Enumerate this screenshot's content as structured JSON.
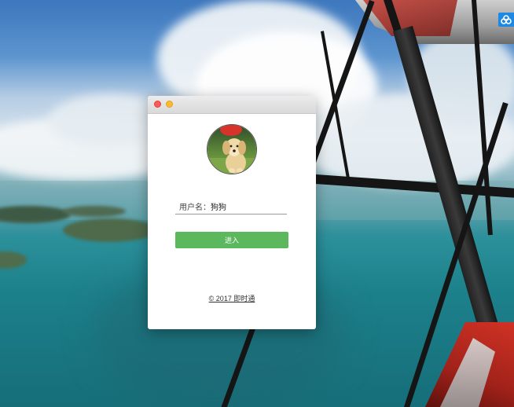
{
  "window": {
    "controls": [
      "close",
      "minimize"
    ],
    "avatar_icon": "puppy-photo"
  },
  "login": {
    "username_label": "用户名：",
    "username_value": "狗狗",
    "enter_label": "进入"
  },
  "footer": {
    "copyright": "© 2017 即时通"
  },
  "tray": {
    "icon": "cloud-app-icon"
  },
  "colors": {
    "enter_button": "#5cb85c",
    "close_button": "#fc5b57",
    "minimize_button": "#fdbc2e",
    "tray_icon": "#1e88e5"
  }
}
